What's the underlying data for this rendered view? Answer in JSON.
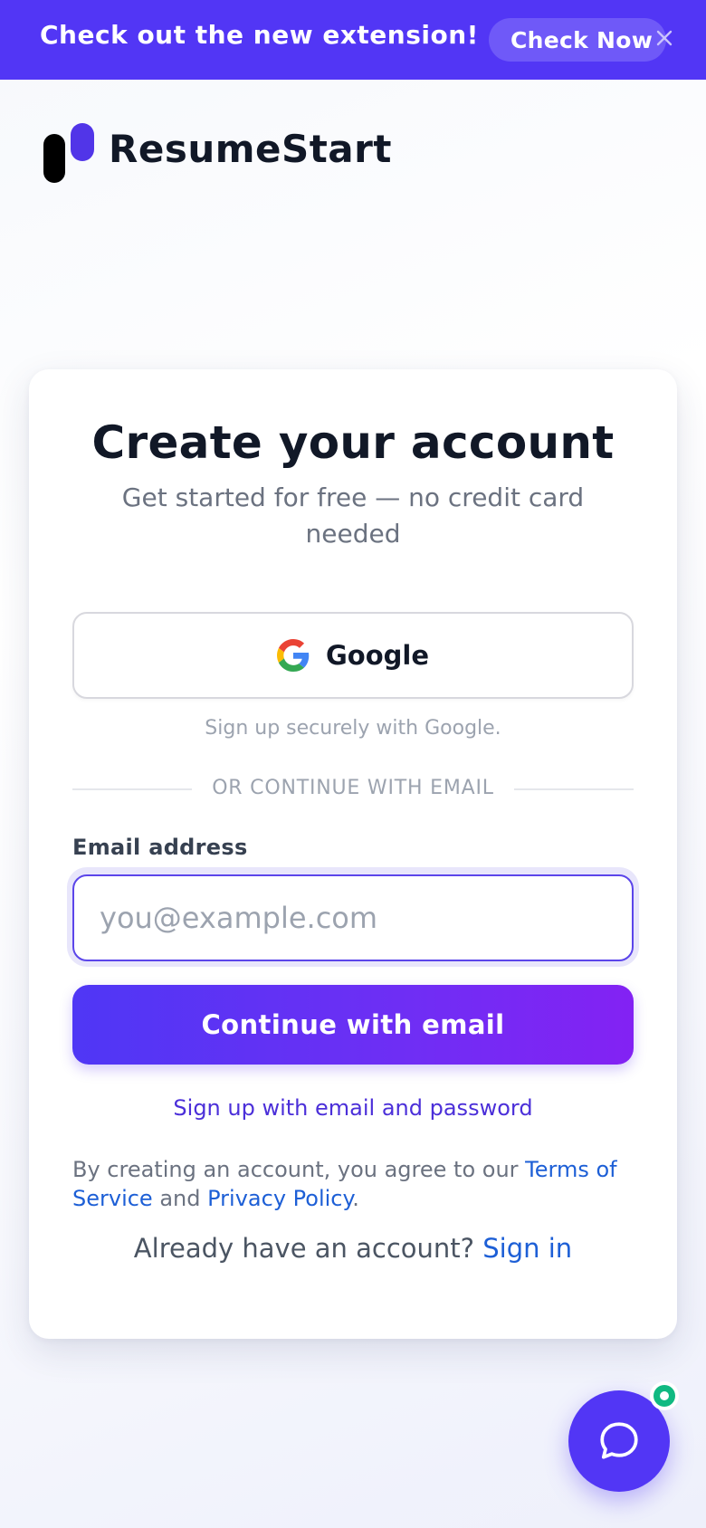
{
  "banner": {
    "text": "Check out the new extension!",
    "button_label": "Check Now",
    "close_icon": "close-icon"
  },
  "brand": {
    "name": "ResumeStart",
    "logo_colors": [
      "#000000",
      "#5135e8"
    ]
  },
  "card": {
    "title": "Create your account",
    "subtitle": "Get started for free — no credit card needed",
    "google_button_label": "Google",
    "google_hint": "Sign up securely with Google.",
    "divider_text": "OR CONTINUE WITH EMAIL",
    "email_label": "Email address",
    "email_placeholder": "you@example.com",
    "email_value": "",
    "continue_label": "Continue with email",
    "password_link": "Sign up with email and password",
    "terms": {
      "prefix": "By creating an account, you agree to our ",
      "tos_link": "Terms of Service",
      "middle": " and ",
      "privacy_link": "Privacy Policy",
      "suffix": "."
    },
    "signin": {
      "prompt": "Already have an account? ",
      "link": "Sign in"
    }
  },
  "chat": {
    "icon": "chat-bubble-icon",
    "status": "online"
  },
  "colors": {
    "accent": "#5236f5",
    "link": "#1d5fd6",
    "online": "#10b981"
  }
}
